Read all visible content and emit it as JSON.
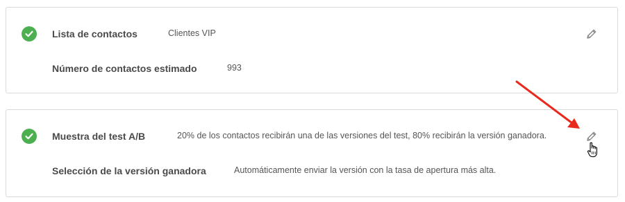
{
  "sections": [
    {
      "rows": [
        {
          "label": "Lista de contactos",
          "value": "Clientes VIP"
        },
        {
          "label": "Número de contactos estimado",
          "value": "993"
        }
      ],
      "status_icon": "check-circle-icon",
      "edit_icon": "pencil-icon"
    },
    {
      "rows": [
        {
          "label": "Muestra del test A/B",
          "value": "20% de los contactos recibirán una de las versiones del test, 80% recibirán la versión ganadora."
        },
        {
          "label": "Selección de la versión ganadora",
          "value": "Automáticamente enviar la versión con la tasa de apertura más alta."
        }
      ],
      "status_icon": "check-circle-icon",
      "edit_icon": "pencil-icon"
    }
  ],
  "colors": {
    "success": "#4caf50",
    "annotation_arrow": "#e8291c",
    "label_text": "#4a4a4a",
    "value_text": "#555555",
    "border": "#dadada"
  }
}
